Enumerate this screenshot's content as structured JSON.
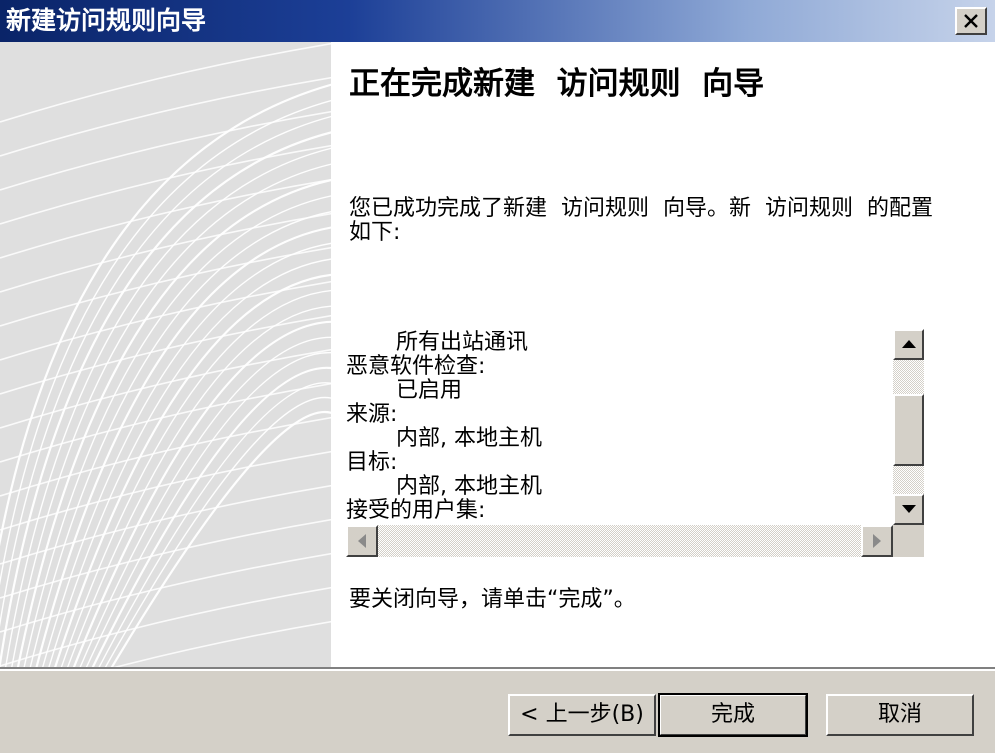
{
  "window": {
    "title": "新建访问规则向导"
  },
  "content": {
    "heading": "正在完成新建  访问规则  向导",
    "description": "您已成功完成了新建  访问规则  向导。新  访问规则  的配置如下:",
    "summary_lines": [
      {
        "text": "所有出站通讯",
        "indent": true
      },
      {
        "text": "恶意软件检查:",
        "indent": false
      },
      {
        "text": "已启用",
        "indent": true
      },
      {
        "text": "来源:",
        "indent": false
      },
      {
        "text": "内部, 本地主机",
        "indent": true
      },
      {
        "text": "目标:",
        "indent": false
      },
      {
        "text": "内部, 本地主机",
        "indent": true
      },
      {
        "text": "接受的用户集:",
        "indent": false
      }
    ],
    "footer_note": "要关闭向导，请单击“完成”。"
  },
  "buttons": {
    "back": "< 上一步(B)",
    "finish": "完成",
    "cancel": "取消"
  },
  "scroll": {
    "vertical_position": 0.55
  },
  "colors": {
    "title_start": "#0a2468",
    "title_end": "#c6d3ea",
    "face": "#d4d0c8"
  },
  "icons": {
    "close": "close-icon",
    "up": "arrow-up-icon",
    "down": "arrow-down-icon",
    "left": "arrow-left-icon",
    "right": "arrow-right-icon"
  }
}
